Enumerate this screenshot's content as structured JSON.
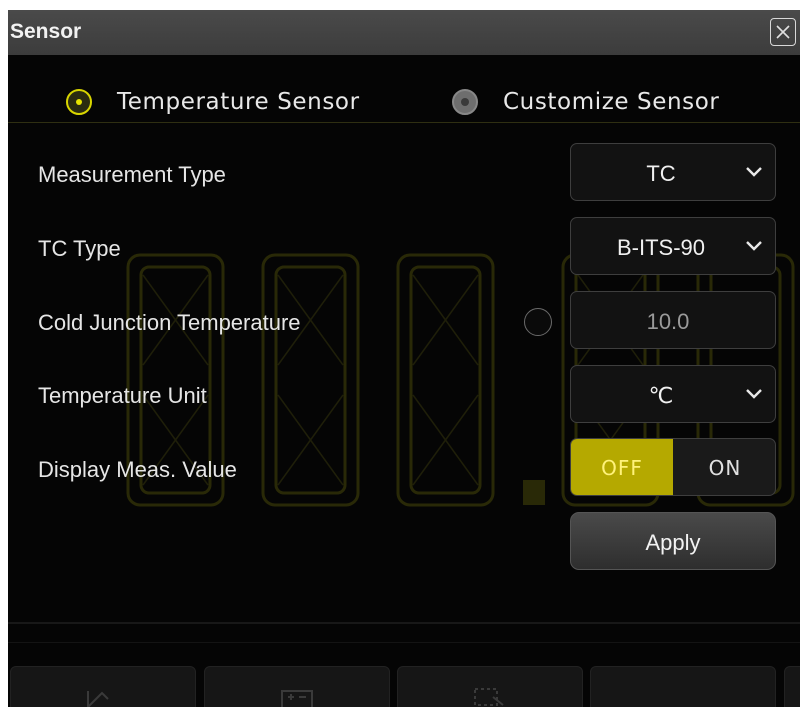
{
  "dialog": {
    "title": "Sensor"
  },
  "sensor_mode": {
    "options": [
      {
        "label": "Temperature Sensor",
        "selected": true
      },
      {
        "label": "Customize Sensor",
        "selected": false
      }
    ]
  },
  "fields": {
    "measurement_type": {
      "label": "Measurement Type",
      "value": "TC"
    },
    "tc_type": {
      "label": "TC Type",
      "value": "B-ITS-90"
    },
    "cold_junction": {
      "label": "Cold Junction Temperature",
      "value": "10.0"
    },
    "temperature_unit": {
      "label": "Temperature Unit",
      "value": "℃"
    },
    "display_meas_value": {
      "label": "Display Meas. Value",
      "off_label": "OFF",
      "on_label": "ON",
      "state": "OFF"
    }
  },
  "apply_label": "Apply",
  "background_reading": "000.00",
  "colors": {
    "accent": "#d8d500",
    "toggle_active": "#b5a900",
    "panel": "#050505",
    "titlebar": "#444444"
  },
  "icons": [
    "close-icon",
    "chevron-down-icon",
    "math-icon",
    "function-icon",
    "region-select-icon",
    "dot-icon"
  ]
}
